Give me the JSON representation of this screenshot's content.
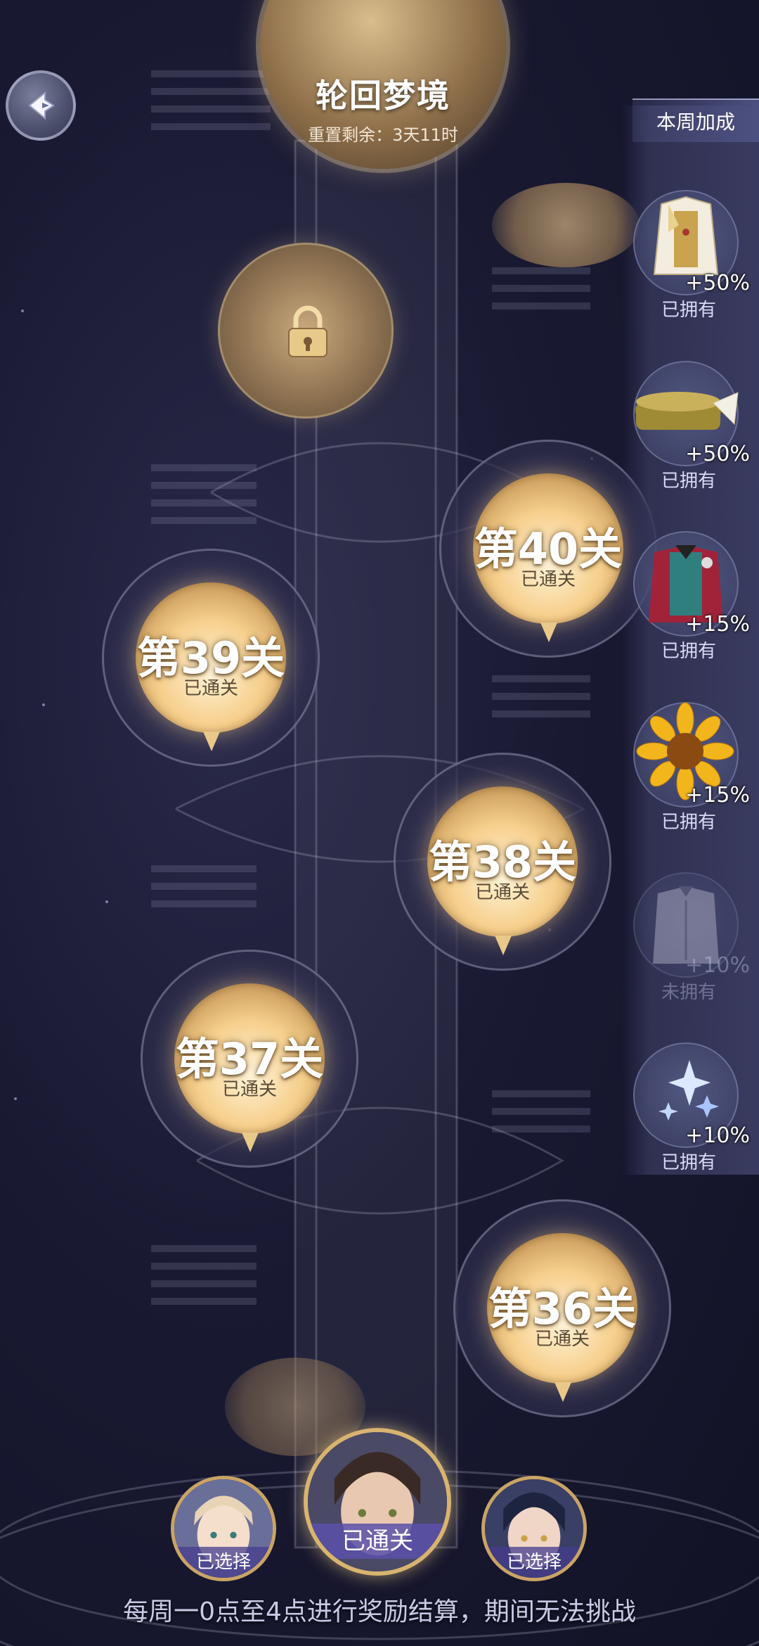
{
  "header": {
    "title": "轮回梦境",
    "reset_text": "重置剩余：3天11时"
  },
  "bonus_panel": {
    "title": "本周加成",
    "items": [
      {
        "icon": "costume-white-gold-icon",
        "percent": "+50%",
        "status": "已拥有",
        "owned": true
      },
      {
        "icon": "hat-icon",
        "percent": "+50%",
        "status": "已拥有",
        "owned": true
      },
      {
        "icon": "red-jacket-icon",
        "percent": "+15%",
        "status": "已拥有",
        "owned": true
      },
      {
        "icon": "sunflower-icon",
        "percent": "+15%",
        "status": "已拥有",
        "owned": true
      },
      {
        "icon": "shirt-icon",
        "percent": "+10%",
        "status": "未拥有",
        "owned": false
      },
      {
        "icon": "sparkle-icon",
        "percent": "+10%",
        "status": "已拥有",
        "owned": true
      }
    ]
  },
  "stages": [
    {
      "name": "第40关",
      "status": "已通关"
    },
    {
      "name": "第39关",
      "status": "已通关"
    },
    {
      "name": "第38关",
      "status": "已通关"
    },
    {
      "name": "第37关",
      "status": "已通关"
    },
    {
      "name": "第36关",
      "status": "已通关"
    }
  ],
  "characters": [
    {
      "label": "已选择",
      "hair": "#e9d3b6"
    },
    {
      "label": "已通关",
      "hair": "#3a2a26"
    },
    {
      "label": "已选择",
      "hair": "#1e2440"
    }
  ],
  "footer": {
    "note": "每周一0点至4点进行奖励结算，期间无法挑战"
  },
  "colors": {
    "background": "#191932",
    "stage_disc": "#f6cf8c",
    "panel": "#3c3e64",
    "accent_gold": "#d8b470"
  }
}
